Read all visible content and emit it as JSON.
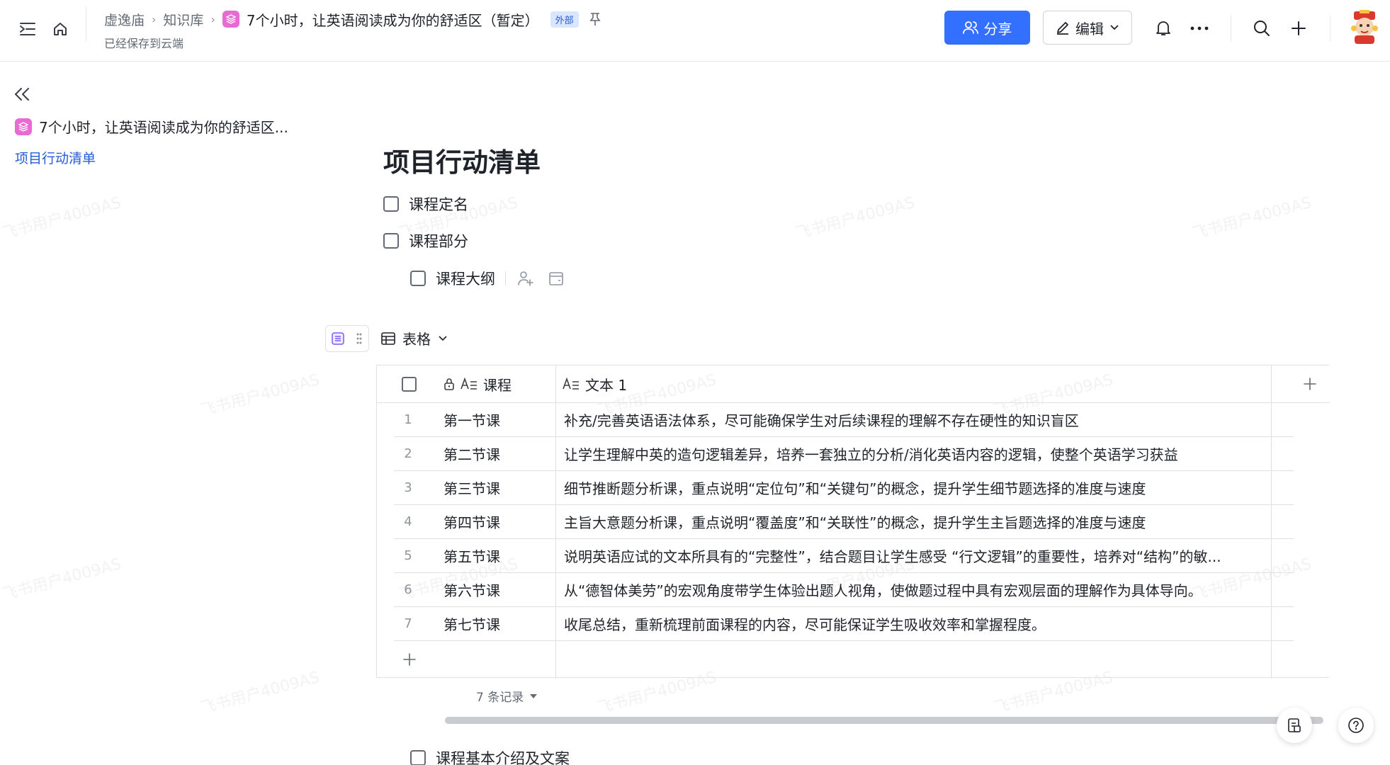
{
  "topbar": {
    "breadcrumb": [
      "虚逸庙",
      "知识库"
    ],
    "doc_title": "7个小时，让英语阅读成为你的舒适区（暂定）",
    "badge": "外部",
    "saved_status": "已经保存到云端",
    "share_label": "分享",
    "edit_label": "编辑"
  },
  "sidebar": {
    "doc_title": "7个小时，让英语阅读成为你的舒适区...",
    "active_item": "项目行动清单"
  },
  "main": {
    "heading": "项目行动清单",
    "todos": [
      {
        "label": "课程定名",
        "checked": false
      },
      {
        "label": "课程部分",
        "checked": false
      },
      {
        "label": "课程大纲",
        "checked": false
      }
    ],
    "last_todo": {
      "label": "课程基本介绍及文案",
      "checked": false
    }
  },
  "table": {
    "view_name": "表格",
    "columns": [
      "课程",
      "文本 1"
    ],
    "rows": [
      {
        "num": "1",
        "course": "第一节课",
        "text": "补充/完善英语语法体系，尽可能确保学生对后续课程的理解不存在硬性的知识盲区"
      },
      {
        "num": "2",
        "course": "第二节课",
        "text": "让学生理解中英的造句逻辑差异，培养一套独立的分析/消化英语内容的逻辑，使整个英语学习获益"
      },
      {
        "num": "3",
        "course": "第三节课",
        "text": "细节推断题分析课，重点说明“定位句”和“关键句”的概念，提升学生细节题选择的准度与速度"
      },
      {
        "num": "4",
        "course": "第四节课",
        "text": "主旨大意题分析课，重点说明“覆盖度”和“关联性”的概念，提升学生主旨题选择的准度与速度"
      },
      {
        "num": "5",
        "course": "第五节课",
        "text": "说明英语应试的文本所具有的“完整性”，结合题目让学生感受 “行文逻辑”的重要性，培养对“结构”的敏..."
      },
      {
        "num": "6",
        "course": "第六节课",
        "text": "从“德智体美劳”的宏观角度带学生体验出题人视角，使做题过程中具有宏观层面的理解作为具体导向。"
      },
      {
        "num": "7",
        "course": "第七节课",
        "text": "收尾总结，重新梳理前面课程的内容，尽可能保证学生吸收效率和掌握程度。"
      }
    ],
    "record_count": "7 条记录"
  },
  "watermark": "飞书用户4009AS",
  "colors": {
    "accent": "#3370ff",
    "doc_icon": "#e86ad3",
    "link": "#245bdb"
  }
}
